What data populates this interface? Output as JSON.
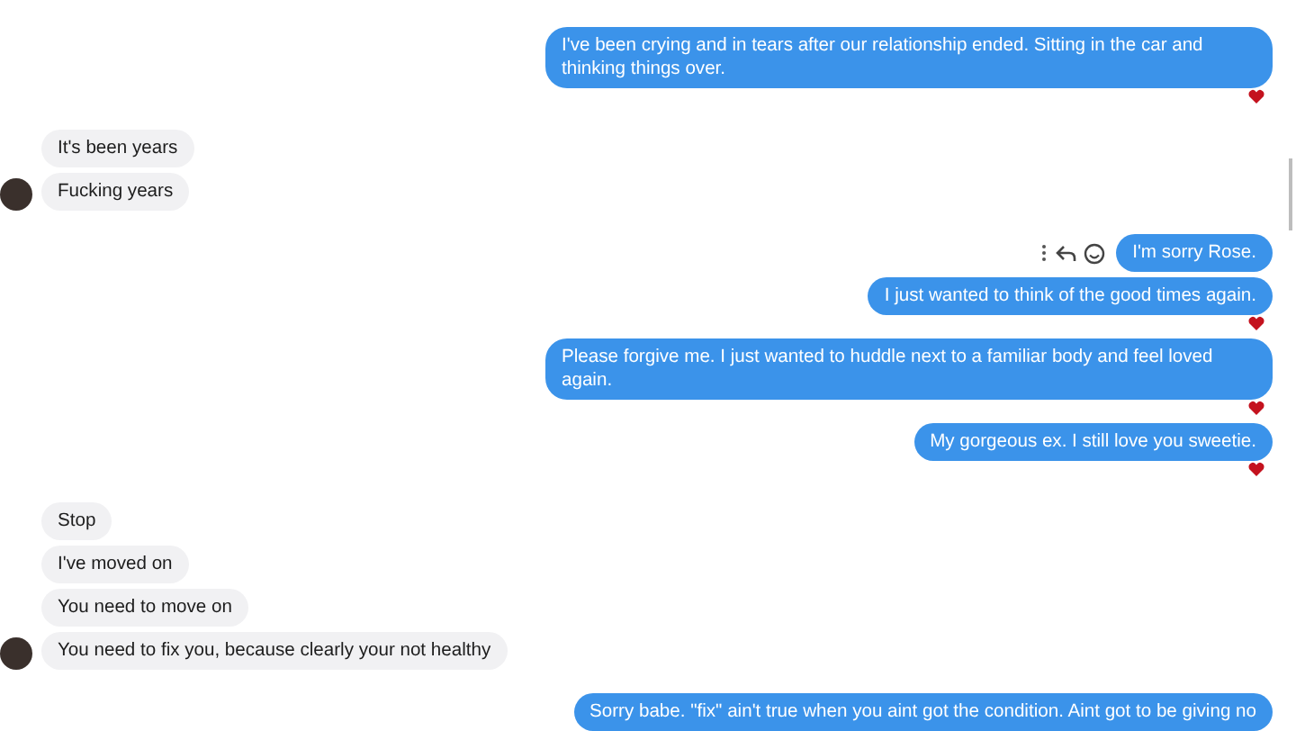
{
  "messages": [
    {
      "kind": "sent",
      "text": "I've been crying and in tears after our relationship ended. Sitting in the car and thinking things over.",
      "reacted": true,
      "avatar": false,
      "actions": false
    },
    {
      "kind": "received",
      "text": "It's been years",
      "reacted": false,
      "avatar": false,
      "actions": false
    },
    {
      "kind": "received",
      "text": "Fucking years",
      "reacted": false,
      "avatar": true,
      "actions": false
    },
    {
      "kind": "sent",
      "text": "I'm sorry Rose.",
      "reacted": false,
      "avatar": false,
      "actions": true
    },
    {
      "kind": "sent",
      "text": "I just wanted to think of the good times again.",
      "reacted": true,
      "avatar": false,
      "actions": false
    },
    {
      "kind": "sent",
      "text": "Please forgive me. I just wanted to huddle next to a familiar body and feel loved again.",
      "reacted": true,
      "avatar": false,
      "actions": false
    },
    {
      "kind": "sent",
      "text": "My gorgeous ex. I still love you sweetie.",
      "reacted": true,
      "avatar": false,
      "actions": false
    },
    {
      "kind": "received",
      "text": "Stop",
      "reacted": false,
      "avatar": false,
      "actions": false
    },
    {
      "kind": "received",
      "text": "I've moved on",
      "reacted": false,
      "avatar": false,
      "actions": false
    },
    {
      "kind": "received",
      "text": "You need to move on",
      "reacted": false,
      "avatar": false,
      "actions": false
    },
    {
      "kind": "received",
      "text": "You need to fix you, because clearly your not healthy",
      "reacted": false,
      "avatar": true,
      "actions": false
    },
    {
      "kind": "sent",
      "text": "Sorry babe. \"fix\" ain't true when you aint got the condition. Aint got to be giving no",
      "reacted": false,
      "avatar": false,
      "actions": false
    }
  ]
}
